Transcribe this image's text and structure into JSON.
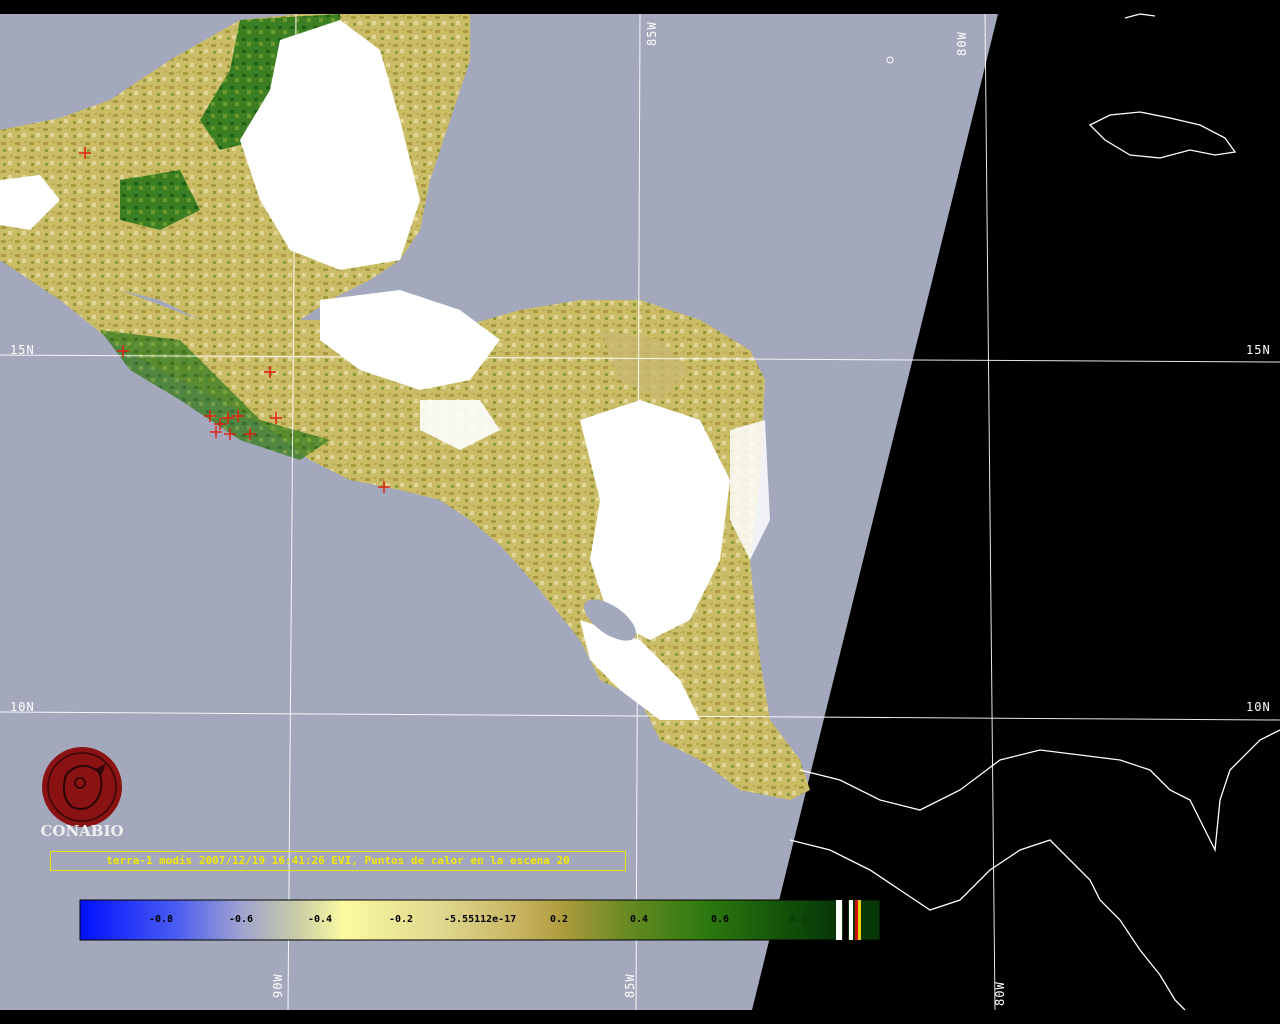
{
  "caption": "terra-1 modis 2007/12/19 16:41:26 EVI, Puntos de calor en la escena 20",
  "logo_text": "CONABIO",
  "grid_labels": {
    "lon_85w_top": "85W",
    "lon_80w_top": "80W",
    "lon_90w_bottom": "90W",
    "lon_85w_bottom": "85W",
    "lon_80w_bottom": "80W",
    "lat_15n_left": "15N",
    "lat_15n_right": "15N",
    "lat_10n_left": "10N",
    "lat_10n_right": "10N"
  },
  "colorbar": {
    "ticks": [
      "-0.8",
      "-0.6",
      "-0.4",
      "-0.2",
      "-5.55112e-17",
      "0.2",
      "0.4",
      "0.6",
      "0.8"
    ]
  },
  "colors": {
    "ocean": "#a4a8bc",
    "no_data": "#000000",
    "cloud": "#ffffff",
    "land_low": "#d8cc80",
    "land_mid": "#a89a40",
    "land_high": "#2e7a1e",
    "hotspot": "#e02010",
    "caption_text": "#f0e800",
    "logo": "#8a1212"
  }
}
